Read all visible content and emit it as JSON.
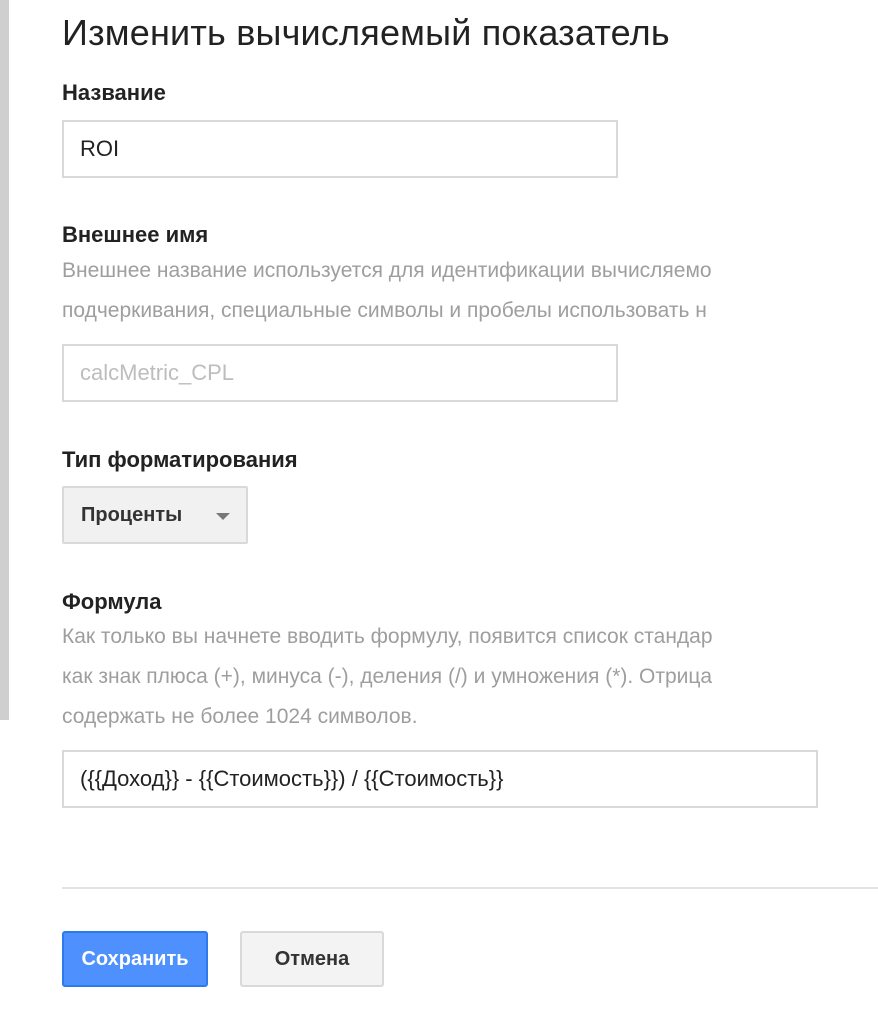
{
  "dialog": {
    "title": "Изменить вычисляемый показатель"
  },
  "name_field": {
    "label": "Название",
    "value": "ROI"
  },
  "external_name": {
    "label": "Внешнее имя",
    "help_line1": "Внешнее название используется для идентификации вычисляемо",
    "help_line2": "подчеркивания, специальные символы и пробелы использовать н",
    "placeholder": "calcMetric_CPL",
    "value": ""
  },
  "format_type": {
    "label": "Тип форматирования",
    "selected": "Проценты"
  },
  "formula": {
    "label": "Формула",
    "help_line1": "Как только вы начнете вводить формулу, появится список стандар",
    "help_line2": "как знак плюса (+), минуса (-), деления (/) и умножения (*). Отрица",
    "help_line3": "содержать не более 1024 символов.",
    "value": "({{Доход}} - {{Стоимость}}) / {{Стоимость}}"
  },
  "actions": {
    "save_label": "Сохранить",
    "cancel_label": "Отмена"
  },
  "colors": {
    "primary_button": "#4d90fe",
    "help_text": "#9e9e9e",
    "side_bar": "#cfcfcf"
  }
}
